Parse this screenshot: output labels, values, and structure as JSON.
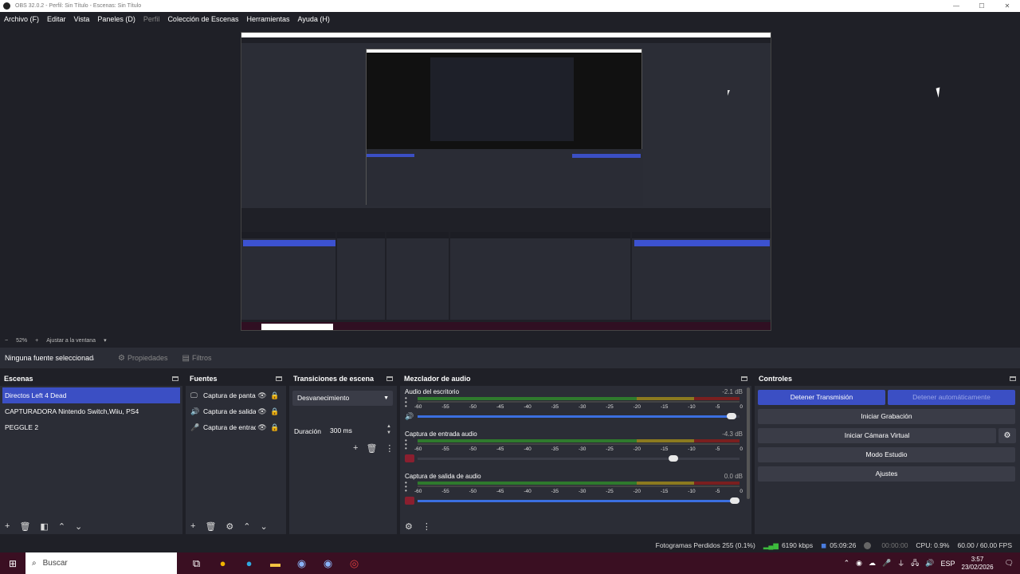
{
  "window": {
    "title": "OBS 32.0.2 - Perfil: Sin Título - Escenas: Sin Título",
    "min": "—",
    "max": "☐",
    "close": "✕"
  },
  "menu": [
    "Archivo (F)",
    "Editar",
    "Vista",
    "Paneles (D)",
    "Perfil",
    "Colección de Escenas",
    "Herramientas",
    "Ayuda (H)"
  ],
  "zoom": {
    "minus": "−",
    "value": "52%",
    "plus": "+",
    "fit": "Ajustar a la ventana",
    "caret": "▾"
  },
  "source_bar": {
    "no_source": "Ninguna fuente seleccionada",
    "properties": "Propiedades",
    "filters": "Filtros"
  },
  "docks": {
    "scenes": {
      "title": "Escenas",
      "items": [
        "Directos Left 4 Dead",
        "CAPTURADORA Nintendo Switch,Wiiu, PS4",
        "PEGGLE 2"
      ]
    },
    "sources": {
      "title": "Fuentes",
      "items": [
        {
          "icon": "🖵",
          "name": "Captura de pantalla"
        },
        {
          "icon": "🔊",
          "name": "Captura de salida de audio"
        },
        {
          "icon": "🎤",
          "name": "Captura de entrada de audio"
        }
      ]
    },
    "transitions": {
      "title": "Transiciones de escena",
      "selected": "Desvanecimiento",
      "duration_label": "Duración",
      "duration_value": "300 ms"
    },
    "mixer": {
      "title": "Mezclador de audio",
      "ticks": [
        "-60",
        "-55",
        "-50",
        "-45",
        "-40",
        "-35",
        "-30",
        "-25",
        "-20",
        "-15",
        "-10",
        "-5",
        "0"
      ],
      "channels": [
        {
          "name": "Audio del escritorio",
          "db": "-2.1 dB",
          "level": 0.99,
          "muted": false
        },
        {
          "name": "Captura de entrada audio",
          "db": "-4.3 dB",
          "level": 0.81,
          "muted": true
        },
        {
          "name": "Captura de salida de audio",
          "db": "0.0 dB",
          "level": 1.0,
          "muted": true
        }
      ]
    },
    "controls": {
      "title": "Controles",
      "stop_stream": "Detener Transmisión",
      "stop_auto": "Detener automáticamente",
      "start_record": "Iniciar Grabación",
      "virtual_cam": "Iniciar Cámara Virtual",
      "studio_mode": "Modo Estudio",
      "settings": "Ajustes"
    }
  },
  "status": {
    "dropped": "Fotogramas Perdidos 255 (0.1%)",
    "bitrate": "6190 kbps",
    "stream_time": "05:09:26",
    "rec_time": "00:00:00",
    "cpu": "CPU: 0.9%",
    "fps": "60.00 / 60.00 FPS"
  },
  "taskbar": {
    "search": "Buscar",
    "lang": "ESP",
    "time": "3:57",
    "date": "23/02/2026"
  }
}
